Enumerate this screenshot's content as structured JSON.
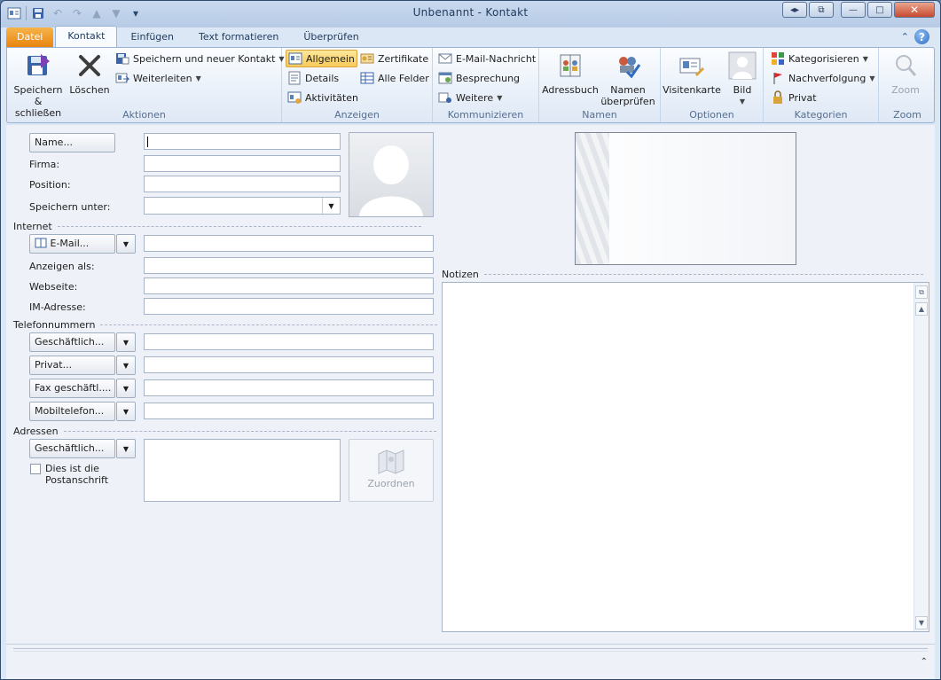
{
  "window": {
    "title": "Unbenannt - Kontakt",
    "controls": {
      "restore": "◂▸",
      "popout": "⧉",
      "minimize": "—",
      "maximize": "□",
      "close": "✕"
    }
  },
  "tabs": [
    {
      "label": "Datei"
    },
    {
      "label": "Kontakt"
    },
    {
      "label": "Einfügen"
    },
    {
      "label": "Text formatieren"
    },
    {
      "label": "Überprüfen"
    }
  ],
  "ribbon": {
    "aktionen": {
      "label": "Aktionen",
      "save_close": "Speichern & schließen",
      "delete": "Löschen",
      "save_new": "Speichern und neuer Kontakt",
      "forward": "Weiterleiten"
    },
    "anzeigen": {
      "label": "Anzeigen",
      "allgemein": "Allgemein",
      "details": "Details",
      "aktivitaeten": "Aktivitäten",
      "zertifikate": "Zertifikate",
      "alle_felder": "Alle Felder"
    },
    "kommunizieren": {
      "label": "Kommunizieren",
      "email": "E-Mail-Nachricht",
      "meeting": "Besprechung",
      "more": "Weitere"
    },
    "namen": {
      "label": "Namen",
      "adressbuch": "Adressbuch",
      "check_names": "Namen überprüfen"
    },
    "optionen": {
      "label": "Optionen",
      "visitenkarte": "Visitenkarte",
      "bild": "Bild"
    },
    "kategorien": {
      "label": "Kategorien",
      "kategorisieren": "Kategorisieren",
      "nachverfolgung": "Nachverfolgung",
      "privat": "Privat"
    },
    "zoom": {
      "label": "Zoom",
      "zoom": "Zoom"
    }
  },
  "form": {
    "name_button": "Name...",
    "firma": "Firma:",
    "position": "Position:",
    "speichern_unter": "Speichern unter:",
    "internet": "Internet",
    "email_button": "E-Mail...",
    "anzeigen_als": "Anzeigen als:",
    "webseite": "Webseite:",
    "im_adresse": "IM-Adresse:",
    "telefonnummern": "Telefonnummern",
    "phone_buttons": [
      "Geschäftlich...",
      "Privat...",
      "Fax geschäftl....",
      "Mobiltelefon..."
    ],
    "adressen": "Adressen",
    "address_button": "Geschäftlich...",
    "postal_checkbox": "Dies ist die Postanschrift",
    "map_button": "Zuordnen",
    "notizen": "Notizen"
  },
  "colors": {
    "accent_file_tab": "#e8840f",
    "selected_button": "#f7c95a",
    "title_text": "#1e395b"
  }
}
